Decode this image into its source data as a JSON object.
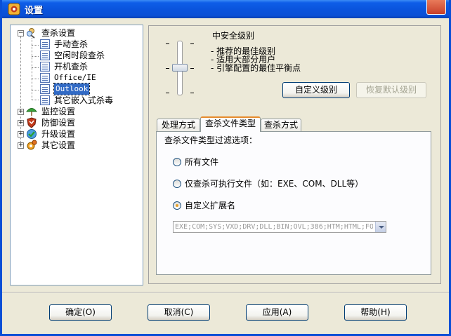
{
  "window": {
    "title": "设置"
  },
  "tree": {
    "root": "查杀设置",
    "children": [
      "手动查杀",
      "空闲时段查杀",
      "开机查杀",
      "Office/IE",
      "Outlook",
      "其它嵌入式杀毒"
    ],
    "selected": "Outlook",
    "others": [
      "监控设置",
      "防御设置",
      "升级设置",
      "其它设置"
    ]
  },
  "security": {
    "level_title": "中安全级别",
    "lines": [
      "- 推荐的最佳级别",
      "- 适用大部分用户",
      "- 引擎配置的最佳平衡点"
    ],
    "custom_button": "自定义级别",
    "restore_button": "恢复默认级别"
  },
  "tabs": [
    "处理方式",
    "查杀文件类型",
    "查杀方式"
  ],
  "active_tab": "查杀文件类型",
  "filter": {
    "label": "查杀文件类型过滤选项：",
    "options": [
      "所有文件",
      "仅查杀可执行文件（如：EXE、COM、DLL等）",
      "自定义扩展名"
    ],
    "selected_index": 2,
    "extensions": "EXE;COM;SYS;VXD;DRV;DLL;BIN;OVL;386;HTM;HTML;FO"
  },
  "footer": {
    "ok": "确定(O)",
    "cancel": "取消(C)",
    "apply": "应用(A)",
    "help": "帮助(H)"
  },
  "colors": {
    "titlebar": "#0a54dd",
    "selection": "#316ac5",
    "tab_accent": "#e68b2c"
  }
}
